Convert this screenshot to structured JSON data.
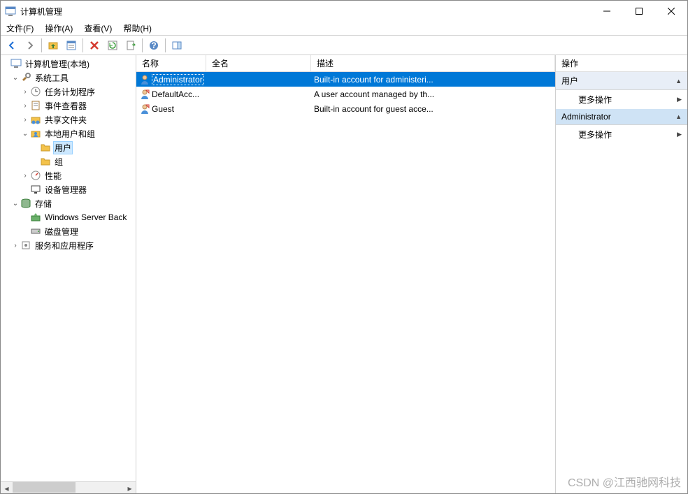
{
  "window": {
    "title": "计算机管理"
  },
  "menu": {
    "file": "文件(F)",
    "action": "操作(A)",
    "view": "查看(V)",
    "help": "帮助(H)"
  },
  "tree": {
    "root": "计算机管理(本地)",
    "system_tools": "系统工具",
    "task_scheduler": "任务计划程序",
    "event_viewer": "事件查看器",
    "shared_folders": "共享文件夹",
    "local_users_groups": "本地用户和组",
    "users": "用户",
    "groups": "组",
    "performance": "性能",
    "device_manager": "设备管理器",
    "storage": "存储",
    "wsb": "Windows Server Back",
    "disk_mgmt": "磁盘管理",
    "services_apps": "服务和应用程序"
  },
  "list": {
    "columns": {
      "name": "名称",
      "fullname": "全名",
      "desc": "描述"
    },
    "rows": [
      {
        "name": "Administrator",
        "fullname": "",
        "desc": "Built-in account for administeri..."
      },
      {
        "name": "DefaultAcc...",
        "fullname": "",
        "desc": "A user account managed by th..."
      },
      {
        "name": "Guest",
        "fullname": "",
        "desc": "Built-in account for guest acce..."
      }
    ]
  },
  "actions": {
    "title": "操作",
    "section1": "用户",
    "more1": "更多操作",
    "section2": "Administrator",
    "more2": "更多操作"
  },
  "watermark": "CSDN @江西驰网科技"
}
